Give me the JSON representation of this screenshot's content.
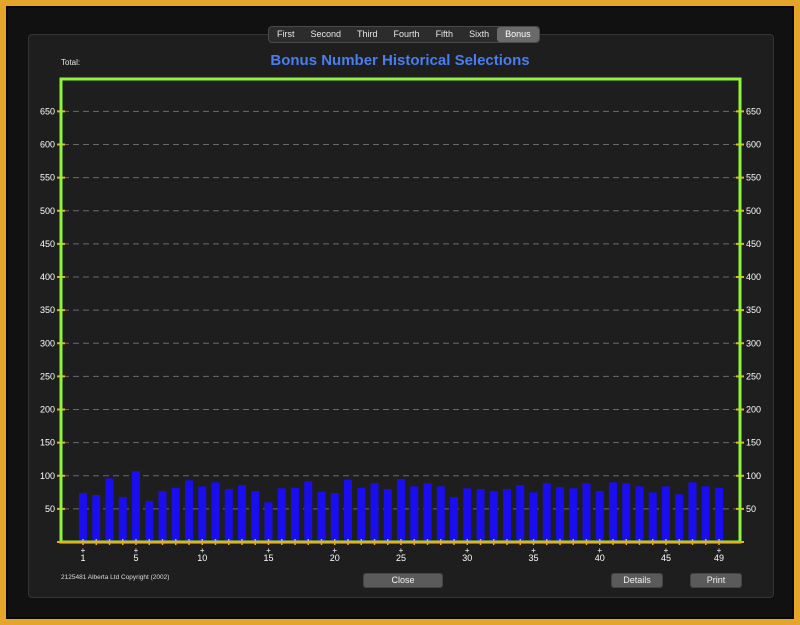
{
  "tabs": [
    "First",
    "Second",
    "Third",
    "Fourth",
    "Fifth",
    "Sixth",
    "Bonus"
  ],
  "active_tab": "Bonus",
  "total_label": "Total:",
  "copyright": "2125481 Alberta Ltd Copyright (2002)",
  "buttons": {
    "close": "Close",
    "details": "Details",
    "print": "Print"
  },
  "colors": {
    "bar": "#1a0df0",
    "frame": "#8ef53a",
    "tick": "#e8b01c",
    "title": "#4a7df0",
    "grid": "#6a6a6a"
  },
  "chart_data": {
    "type": "bar",
    "title": "Bonus Number Historical Selections",
    "ylim": [
      0,
      650
    ],
    "yticks": [
      50,
      100,
      150,
      200,
      250,
      300,
      350,
      400,
      450,
      500,
      550,
      600,
      650
    ],
    "xtick_labels": [
      "1",
      "5",
      "10",
      "15",
      "20",
      "25",
      "30",
      "35",
      "40",
      "45",
      "49"
    ],
    "grid": true,
    "categories": [
      1,
      2,
      3,
      4,
      5,
      6,
      7,
      8,
      9,
      10,
      11,
      12,
      13,
      14,
      15,
      16,
      17,
      18,
      19,
      20,
      21,
      22,
      23,
      24,
      25,
      26,
      27,
      28,
      29,
      30,
      31,
      32,
      33,
      34,
      35,
      36,
      37,
      38,
      39,
      40,
      41,
      42,
      43,
      44,
      45,
      46,
      47,
      48,
      49
    ],
    "values": [
      74,
      71,
      96,
      68,
      107,
      62,
      77,
      82,
      93,
      84,
      90,
      80,
      86,
      77,
      60,
      81,
      82,
      92,
      76,
      74,
      94,
      82,
      89,
      80,
      95,
      84,
      89,
      84,
      68,
      81,
      80,
      77,
      80,
      86,
      75,
      89,
      83,
      81,
      89,
      77,
      90,
      89,
      84,
      75,
      84,
      72,
      90,
      84,
      82
    ]
  }
}
